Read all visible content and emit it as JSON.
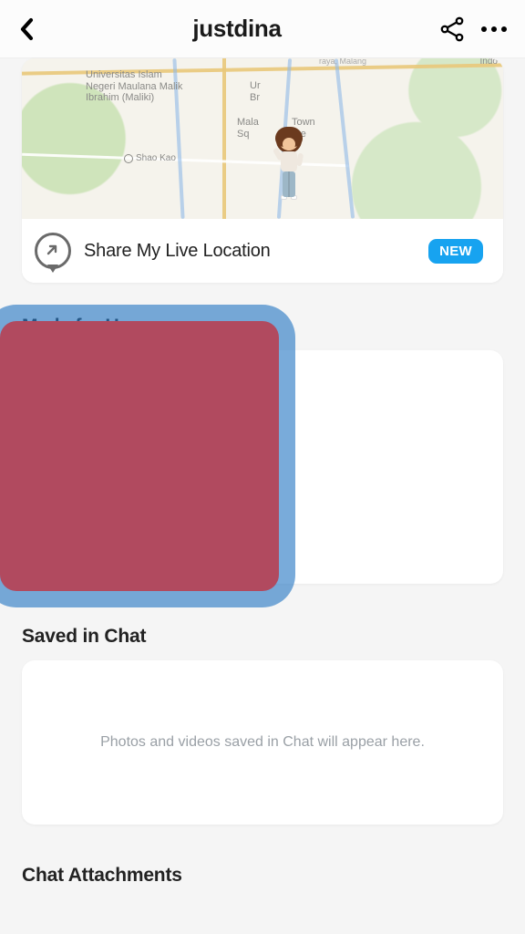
{
  "header": {
    "title": "justdina"
  },
  "map": {
    "labels": {
      "university": "Universitas Islam\nNegeri Maulana Malik\nIbrahim (Maliki)",
      "brawijaya_top": "Ur",
      "brawijaya_bottom": "Br",
      "town_square_top": "Mala",
      "town_square_bottom": "Sq",
      "town_square_right": "Town",
      "town_square_right2": "are",
      "shao_kao": "Shao Kao",
      "top_right": "Indo",
      "top_mid": "raya, Malang"
    },
    "share_label": "Share My Live Location",
    "badge": "NEW"
  },
  "sections": {
    "made_for_us": "Made for Us",
    "saved_in_chat": "Saved in Chat",
    "saved_empty": "Photos and videos saved in Chat will appear here.",
    "chat_attachments": "Chat Attachments"
  }
}
